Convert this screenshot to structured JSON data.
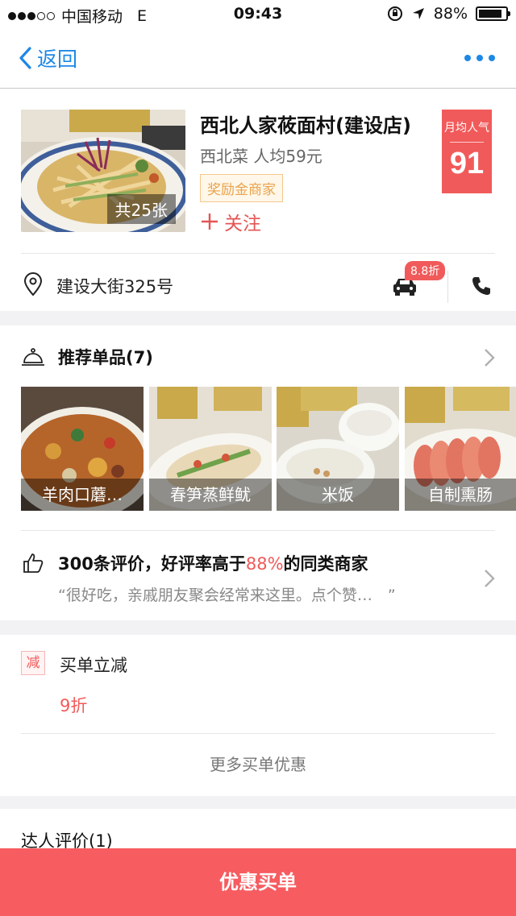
{
  "status_bar": {
    "carrier": "中国移动",
    "network": "E",
    "time": "09:43",
    "battery": "88%",
    "battery_level": 0.88
  },
  "nav": {
    "back_label": "返回"
  },
  "shop": {
    "name": "西北人家莜面村(建设店)",
    "category_price": "西北菜 人均59元",
    "reward_tag": "奖励金商家",
    "follow_label": "关注",
    "photo_count": "共25张",
    "popularity_label": "月均人气",
    "popularity_value": "91",
    "address": "建设大街325号",
    "taxi_discount": "8.8折"
  },
  "recommended": {
    "title": "推荐单品(7)",
    "dishes": [
      {
        "name": "羊肉口蘑…"
      },
      {
        "name": "春笋蒸鲜鱿"
      },
      {
        "name": "米饭"
      },
      {
        "name": "自制熏肠"
      }
    ]
  },
  "reviews": {
    "title_prefix": "300条评价，好评率高于",
    "highlight": "88%",
    "title_suffix": "的同类商家",
    "quote": "“很好吃，亲戚朋友聚会经常来这里。点个赞…　”"
  },
  "discount": {
    "badge": "减",
    "title": "买单立减",
    "value": "9折",
    "more_label": "更多买单优惠"
  },
  "expert": {
    "title": "达人评价(1)"
  },
  "bottom": {
    "buy_label": "优惠买单"
  },
  "colors": {
    "accent_blue": "#1e88e5",
    "accent_red": "#f15a5a",
    "buy_bar": "#f65c60"
  }
}
